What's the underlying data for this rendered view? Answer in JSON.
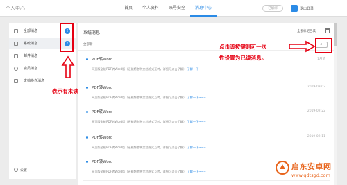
{
  "header": {
    "app_title": "个人中心",
    "nav": [
      "首页",
      "个人资料",
      "账号安全",
      "消息中心"
    ],
    "nav_active_index": 3,
    "button": "已解绑",
    "user_name": "退出登录"
  },
  "sidebar": {
    "items": [
      {
        "label": "全部消息",
        "badge": "!"
      },
      {
        "label": "系统消息",
        "badge": "!"
      },
      {
        "label": "邮件消息",
        "badge": ""
      },
      {
        "label": "会员消息",
        "badge": ""
      },
      {
        "label": "文档协作消息",
        "badge": ""
      }
    ],
    "active_index": 1,
    "settings_label": "设置"
  },
  "main": {
    "title": "系统消息",
    "mark_all_read": "全部标记已读",
    "sub_label": "全部新",
    "search_icon": "search-icon",
    "messages": [
      {
        "title": "PDF转Word",
        "body": "网页版全能PDF转Word版（还能将各种文档格式互转，详细可点击了解）",
        "more": "了解一下~~~",
        "date": "1月前"
      },
      {
        "title": "PDF转Word",
        "body": "网页版全能PDF转Word版（还能将各种文档格式互转，详细可点击了解）",
        "more": "了解一下~~~",
        "date": "2019-03-02"
      },
      {
        "title": "PDF转Word",
        "body": "网页版全能PDF转Word版（还能将各种文档格式互转，详细可点击了解）",
        "more": "了解一下~~~",
        "date": "2019-02-22"
      },
      {
        "title": "PDF转Word",
        "body": "网页版全能PDF转Word版（还能将各种文档格式互转，详细可点击了解）",
        "more": "了解一下~~~",
        "date": "2019-02-11"
      },
      {
        "title": "PDF转Word",
        "body": "网页版全能PDF转Word版（还能将各种文档格式互转，详细可点击了解）",
        "more": "了解一下~~~",
        "date": ""
      }
    ]
  },
  "annotations": {
    "left_text": "表示有未读",
    "right_text_line1": "点击该按键则可一次",
    "right_text_line2": "性设置为已读消息。",
    "color": "#e60012"
  },
  "watermark": {
    "cn": "启东安卓网",
    "url": "www.qdtsgd.com",
    "color": "#e8641b"
  }
}
